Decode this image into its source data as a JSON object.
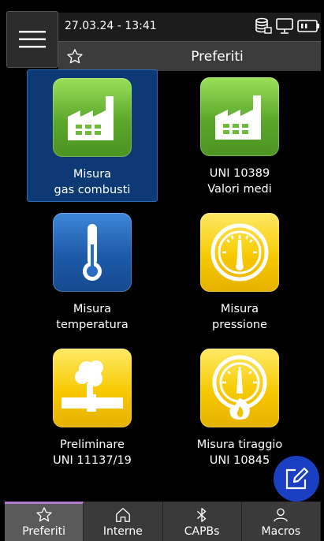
{
  "status": {
    "datetime": "27.03.24 - 13:41"
  },
  "header": {
    "title": "Preferiti"
  },
  "tiles": [
    {
      "line1": "Misura",
      "line2": "gas combusti",
      "icon": "factory-icon",
      "color": "green",
      "selected": true
    },
    {
      "line1": "UNI 10389",
      "line2": "Valori medi",
      "icon": "factory-icon",
      "color": "green"
    },
    {
      "line1": "Misura",
      "line2": "temperatura",
      "icon": "thermometer-icon",
      "color": "blue"
    },
    {
      "line1": "Misura",
      "line2": "pressione",
      "icon": "gauge-icon",
      "color": "yellow"
    },
    {
      "line1": "Preliminare",
      "line2": "UNI 11137/19",
      "icon": "gas-leak-icon",
      "color": "yellow"
    },
    {
      "line1": "Misura tiraggio",
      "line2": "UNI 10845",
      "icon": "draft-gauge-icon",
      "color": "yellow"
    }
  ],
  "nav": [
    {
      "label": "Preferiti",
      "icon": "star-icon",
      "active": true
    },
    {
      "label": "Interne",
      "icon": "home-icon"
    },
    {
      "label": "CAPBs",
      "icon": "bluetooth-icon"
    },
    {
      "label": "Macros",
      "icon": "user-icon"
    }
  ],
  "colors": {
    "selected_tile": "#0d3a75",
    "fab": "#1a3fc2",
    "nav_active_accent": "#b07ad1"
  }
}
